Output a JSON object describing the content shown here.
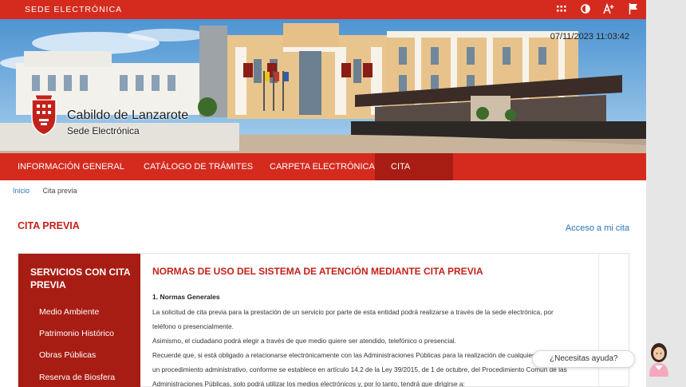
{
  "header": {
    "site_name": "SEDE ELECTRÓNICA",
    "tools": [
      "accessibility-grid-icon",
      "contrast-icon",
      "text-size-icon",
      "flag-icon"
    ]
  },
  "banner": {
    "logo_title": "Cabildo de Lanzarote",
    "logo_subtitle": "Sede Electrónica",
    "datetime": "07/11/2023 11:03:42"
  },
  "nav": {
    "items": [
      {
        "label": "Información general"
      },
      {
        "label": "Catálogo de trámites"
      },
      {
        "label": "Carpeta electrónica"
      },
      {
        "label": "Cita previa"
      }
    ],
    "active_index": 3
  },
  "breadcrumb": {
    "home": "Inicio",
    "current": "Cita previa"
  },
  "page": {
    "title": "Cita previa",
    "acceso_link": "Acceso a mi cita"
  },
  "sidebar": {
    "title": "Servicios con cita previa",
    "items": [
      {
        "label": "Medio Ambiente"
      },
      {
        "label": "Patrimonio Histórico"
      },
      {
        "label": "Obras Públicas"
      },
      {
        "label": "Reserva de Biosfera"
      }
    ]
  },
  "main": {
    "title": "Normas de uso del sistema de atención mediante cita previa",
    "section": "1. Normas Generales",
    "paragraphs": [
      "La solicitud de cita previa para la prestación de un servicio por parte de esta entidad podrá realizarse a través de la sede electrónica, por",
      "teléfono o presencialmente.",
      "Asimismo, el ciudadano podrá elegir a través de que medio quiere ser atendido, telefónico o presencial.",
      "Recuerde que, si está obligado a relacionarse electrónicamente con las Administraciones Públicas para la realización de cualquier trámite de",
      "un procedimiento administrativo, conforme se establece en artículo 14.2 de la Ley 39/2015, de 1 de octubre, del Procedimiento Común de las",
      "Administraciones Públicas, solo podrá utilizar los medios electrónicos y, por lo tanto, tendrá que dirigirse a:"
    ]
  },
  "help": {
    "label": "¿Necesitas ayuda?"
  },
  "colors": {
    "brand_red": "#d42b1e",
    "dark_red": "#a81d13",
    "link_blue": "#2a74b8"
  }
}
